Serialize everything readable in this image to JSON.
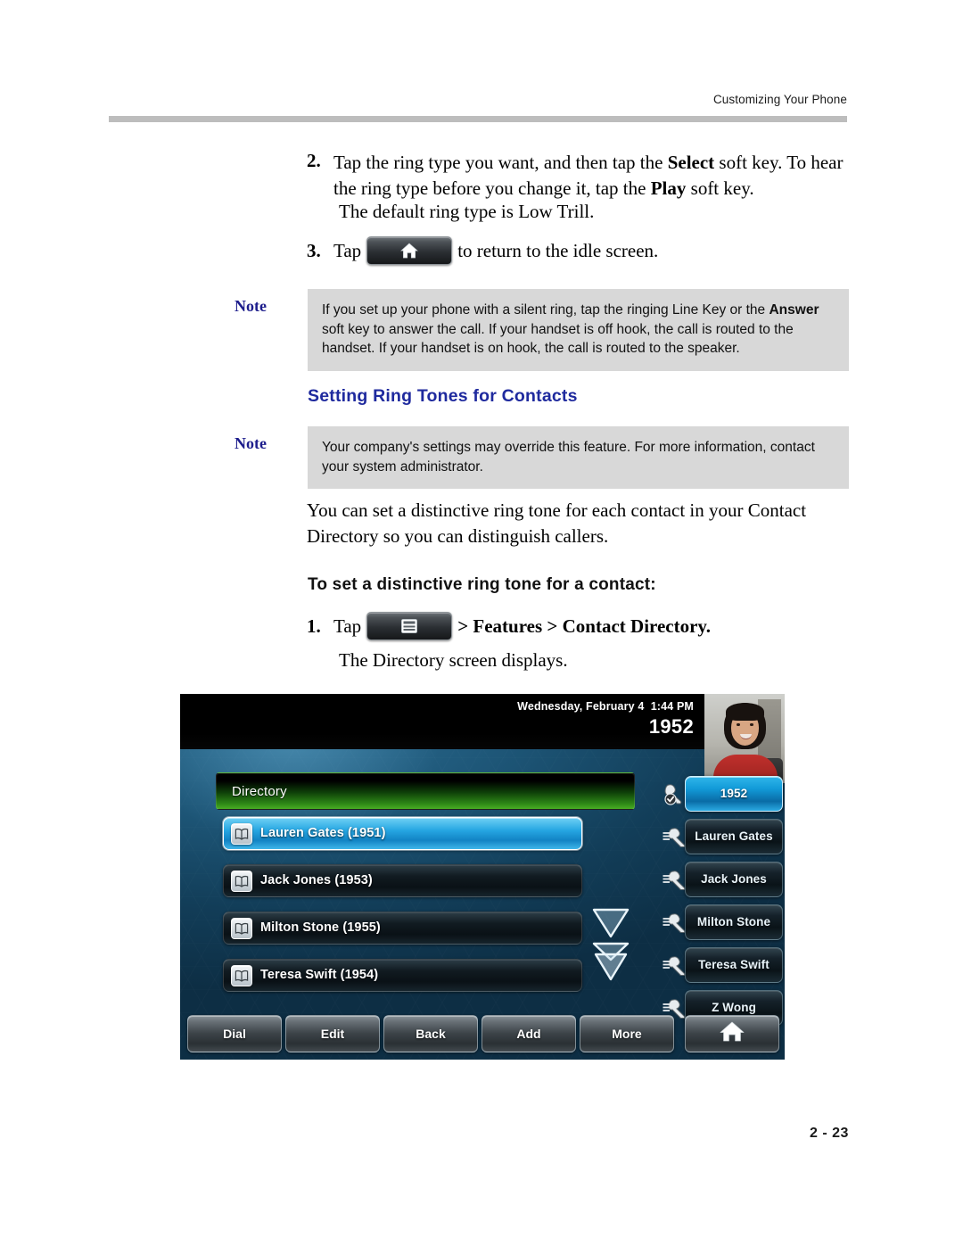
{
  "header": {
    "running_title": "Customizing Your Phone"
  },
  "steps": {
    "step2_num": "2.",
    "step2_text_a": "Tap the ring type you want, and then tap the ",
    "step2_bold_select": "Select",
    "step2_text_b": " soft key. To hear the ring type before you change it, tap the ",
    "step2_bold_play": "Play",
    "step2_text_c": " soft key.",
    "default_ring": "The default ring type is Low Trill.",
    "step3_num": "3.",
    "step3_tap": "Tap",
    "step3_after": "to return to the idle screen.",
    "step1_num": "1.",
    "step1_tap": "Tap",
    "step1_after": "> Features > Contact Directory.",
    "directory_displays": "The Directory screen displays."
  },
  "note1": {
    "label": "Note",
    "line1_a": "If you set up your phone with a silent ring, tap the ringing Line Key or the ",
    "bold": "Answer",
    "line1_b": " soft key to answer the call. If your handset is off hook, the call is routed to the handset. If your handset is on hook, the call is routed to the speaker."
  },
  "note2": {
    "label": "Note",
    "text": "Your company's settings may override this feature. For more information, contact your system administrator."
  },
  "headings": {
    "setting_ring_tones": "Setting Ring Tones for Contacts",
    "to_set_distinctive": "To set a distinctive ring tone for a contact:"
  },
  "body": {
    "distinctive_para": "You can set a distinctive ring tone for each contact in your Contact Directory so you can distinguish callers."
  },
  "phone": {
    "status_date": "Wednesday, February 4  1:44 PM",
    "status_extension": "1952",
    "directory_title": "Directory",
    "contacts": [
      {
        "label": "Lauren Gates (1951)",
        "selected": true,
        "icon": "contact-book-icon"
      },
      {
        "label": "Jack Jones (1953)",
        "selected": false,
        "icon": "contact-book-icon"
      },
      {
        "label": "Milton Stone (1955)",
        "selected": false,
        "icon": "contact-book-icon"
      },
      {
        "label": "Teresa Swift (1954)",
        "selected": false,
        "icon": "contact-book-icon"
      }
    ],
    "line_keys": [
      {
        "label": "1952",
        "active": true,
        "icon": "registered-line-icon"
      },
      {
        "label": "Lauren Gates",
        "active": false,
        "icon": "speed-dial-icon"
      },
      {
        "label": "Jack Jones",
        "active": false,
        "icon": "speed-dial-icon"
      },
      {
        "label": "Milton Stone",
        "active": false,
        "icon": "speed-dial-icon"
      },
      {
        "label": "Teresa Swift",
        "active": false,
        "icon": "speed-dial-icon"
      },
      {
        "label": "Z Wong",
        "active": false,
        "icon": "speed-dial-icon"
      }
    ],
    "soft_keys": [
      {
        "label": "Dial"
      },
      {
        "label": "Edit"
      },
      {
        "label": "Back"
      },
      {
        "label": "Add"
      },
      {
        "label": "More"
      }
    ],
    "home_soft_key_icon": "home-icon",
    "scroll_icons": [
      "scroll-down-icon",
      "scroll-page-down-icon"
    ]
  },
  "footer": {
    "page_number": "2 - 23"
  },
  "colors": {
    "note_label": "#1d1d8c",
    "heading_blue": "#1f2a9e",
    "note_background": "#d8d8d8",
    "rule": "#bdbdbd",
    "phone_accent": "#26a6e2",
    "phone_title_green": "#49ad23"
  }
}
